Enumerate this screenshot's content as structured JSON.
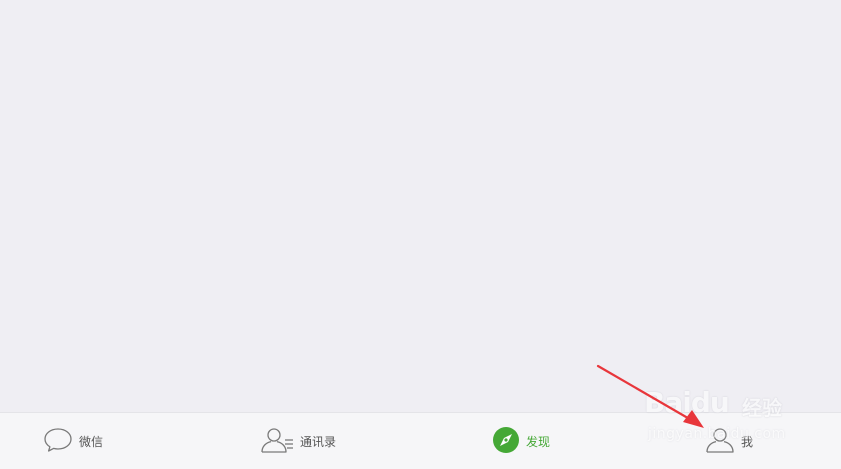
{
  "tabbar": {
    "tabs": [
      {
        "id": "chats",
        "label": "微信",
        "icon": "chat-bubble-icon",
        "active": false
      },
      {
        "id": "contacts",
        "label": "通讯录",
        "icon": "contacts-icon",
        "active": false
      },
      {
        "id": "discover",
        "label": "发现",
        "icon": "compass-icon",
        "active": true
      },
      {
        "id": "me",
        "label": "我",
        "icon": "person-icon",
        "active": false
      }
    ]
  },
  "colors": {
    "background": "#efeef3",
    "tabbar_background": "#f6f6f8",
    "active_green": "#45a836",
    "inactive_icon": "#7a7a7a",
    "annotation_arrow": "#e8363b"
  },
  "watermark": {
    "brand": "Baidu",
    "suffix": "经验",
    "url": "jingyan.baidu.com"
  }
}
